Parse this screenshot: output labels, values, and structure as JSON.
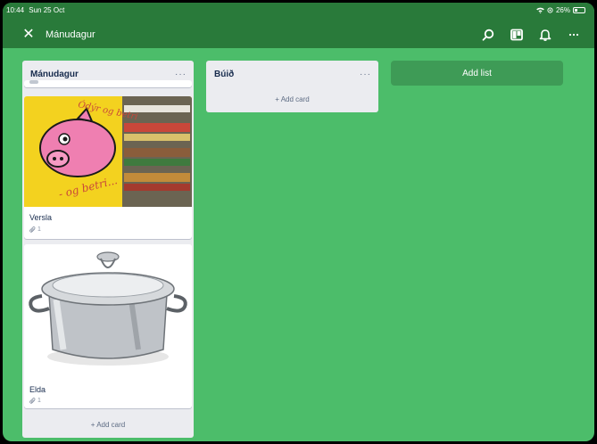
{
  "status": {
    "time": "10:44",
    "date": "Sun 25 Oct",
    "battery": "26%"
  },
  "board": {
    "title": "Mánudagur"
  },
  "icons": {
    "close": "close-icon",
    "search": "search-icon",
    "board_view": "board-icon",
    "notifications": "bell-icon",
    "more": "more-icon"
  },
  "lists": [
    {
      "title": "Mánudagur",
      "menu": "···",
      "cards": [
        {
          "title": "Versla",
          "attachments": "1",
          "image": "piggy-bank-store-photo"
        },
        {
          "title": "Elda",
          "attachments": "1",
          "image": "cooking-pot-photo"
        }
      ],
      "add_card": "+ Add card"
    },
    {
      "title": "Búið",
      "menu": "···",
      "cards": [],
      "add_card": "+ Add card"
    }
  ],
  "add_list": "Add list",
  "colors": {
    "background": "#4cbd6a",
    "appbar": "#297a3a",
    "add_list_button": "#3e9b56"
  }
}
